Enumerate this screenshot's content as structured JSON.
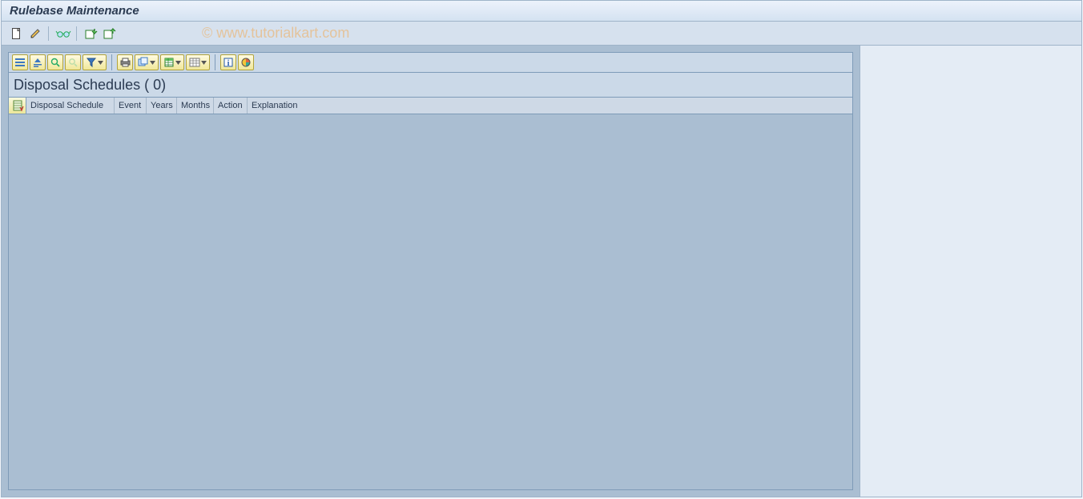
{
  "title": "Rulebase Maintenance",
  "watermark": "© www.tutorialkart.com",
  "main_toolbar": {
    "create": "create-icon",
    "change": "edit-icon",
    "display": "glasses-icon",
    "refresh_in": "import-icon",
    "refresh_out": "export-icon"
  },
  "alv_toolbar": {
    "details": "details-icon",
    "sort_asc": "sort-asc-icon",
    "sort_desc": "sort-desc-icon",
    "find": "find-icon",
    "find_next": "find-next-icon",
    "filter": "filter-icon",
    "print": "print-icon",
    "views": "views-icon",
    "export": "export-xls-icon",
    "layout": "layout-icon",
    "info": "info-icon",
    "graphic": "graphic-icon"
  },
  "grid": {
    "title": "Disposal Schedules  ( 0)",
    "columns": [
      {
        "label": "Disposal Schedule",
        "width": 110
      },
      {
        "label": "Event",
        "width": 40
      },
      {
        "label": "Years",
        "width": 38
      },
      {
        "label": "Months",
        "width": 46
      },
      {
        "label": "Action",
        "width": 42
      },
      {
        "label": "Explanation",
        "width": 70
      }
    ]
  }
}
